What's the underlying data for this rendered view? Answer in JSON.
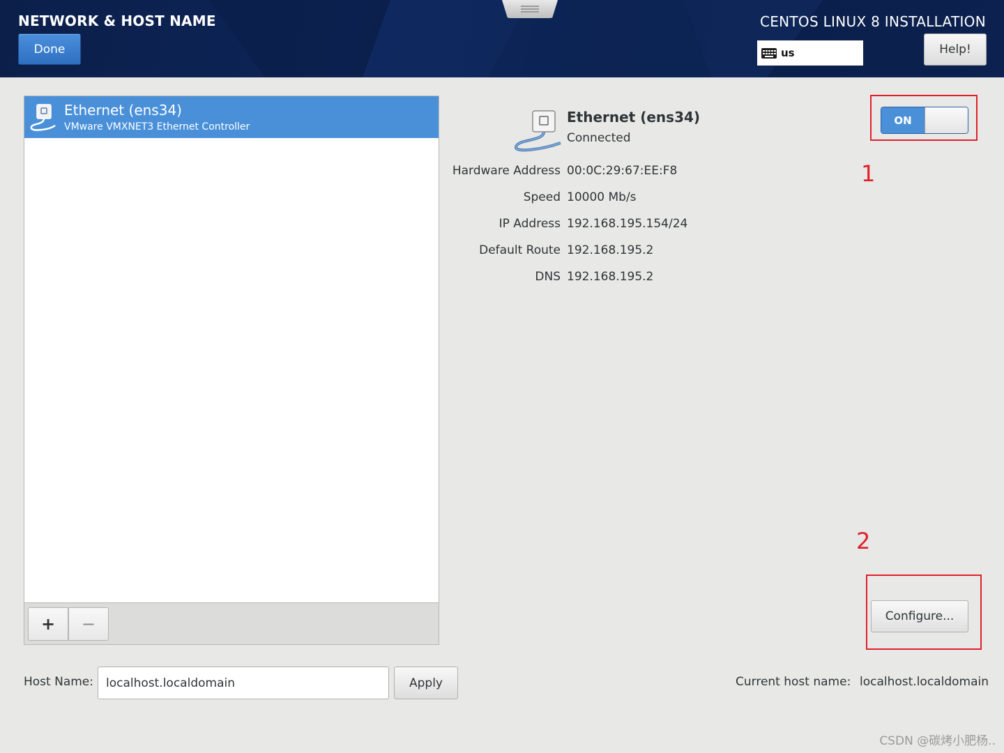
{
  "header": {
    "page_title": "NETWORK & HOST NAME",
    "done_label": "Done",
    "install_title": "CENTOS LINUX 8 INSTALLATION",
    "keyboard_layout": "us",
    "help_label": "Help!"
  },
  "device_list": {
    "items": [
      {
        "name": "Ethernet (ens34)",
        "description": "VMware VMXNET3 Ethernet Controller",
        "selected": true
      }
    ],
    "add_label": "+",
    "remove_label": "−"
  },
  "device_detail": {
    "name": "Ethernet (ens34)",
    "status": "Connected",
    "toggle_label": "ON",
    "toggle_state": "on",
    "properties": [
      {
        "label": "Hardware Address",
        "value": "00:0C:29:67:EE:F8"
      },
      {
        "label": "Speed",
        "value": "10000 Mb/s"
      },
      {
        "label": "IP Address",
        "value": "192.168.195.154/24"
      },
      {
        "label": "Default Route",
        "value": "192.168.195.2"
      },
      {
        "label": "DNS",
        "value": "192.168.195.2"
      }
    ],
    "configure_label": "Configure..."
  },
  "annotations": {
    "marker_1": "1",
    "marker_2": "2"
  },
  "hostname": {
    "label": "Host Name:",
    "value": "localhost.localdomain",
    "apply_label": "Apply",
    "current_label": "Current host name:",
    "current_value": "localhost.localdomain"
  },
  "watermark": "CSDN @碳烤小肥杨..",
  "colors": {
    "header_bg": "#0b1f4a",
    "accent_blue": "#4a90d9",
    "annotation_red": "#e0202a",
    "page_bg": "#e8e8e7"
  }
}
